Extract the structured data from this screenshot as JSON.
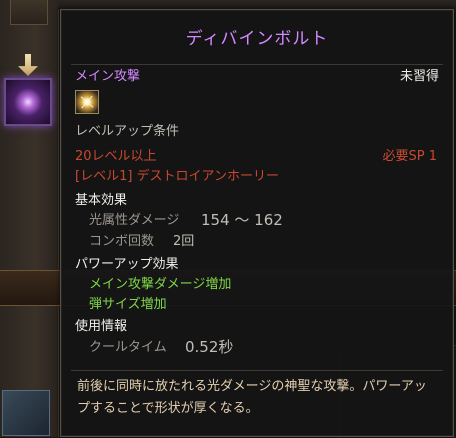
{
  "tooltip": {
    "title": "ディバインボルト",
    "main_attack_label": "メイン攻撃",
    "status": "未習得",
    "skill_icon": "divine-bolt-icon",
    "level_up_header": "レベルアップ条件",
    "level_requirement": "20レベル以上",
    "sp_requirement": "必要SP 1",
    "prerequisite": "[レベル1] デストロイアンホーリー",
    "basic_effect_header": "基本効果",
    "damage_label": "光属性ダメージ",
    "damage_value": "154 ～ 162",
    "combo_label": "コンボ回数",
    "combo_value": "2回",
    "powerup_header": "パワーアップ効果",
    "powerup_effects": [
      "メイン攻撃ダメージ増加",
      "弾サイズ増加"
    ],
    "usage_header": "使用情報",
    "cooldown_label": "クールタイム",
    "cooldown_value": "0.52秒",
    "description": "前後に同時に放たれる光ダメージの神聖な攻撃。パワーアップすることで形状が厚くなる。"
  },
  "colors": {
    "title": "#d48aff",
    "requirement": "#c9492f",
    "powerup": "#7fd648",
    "description": "#e3cfae"
  }
}
